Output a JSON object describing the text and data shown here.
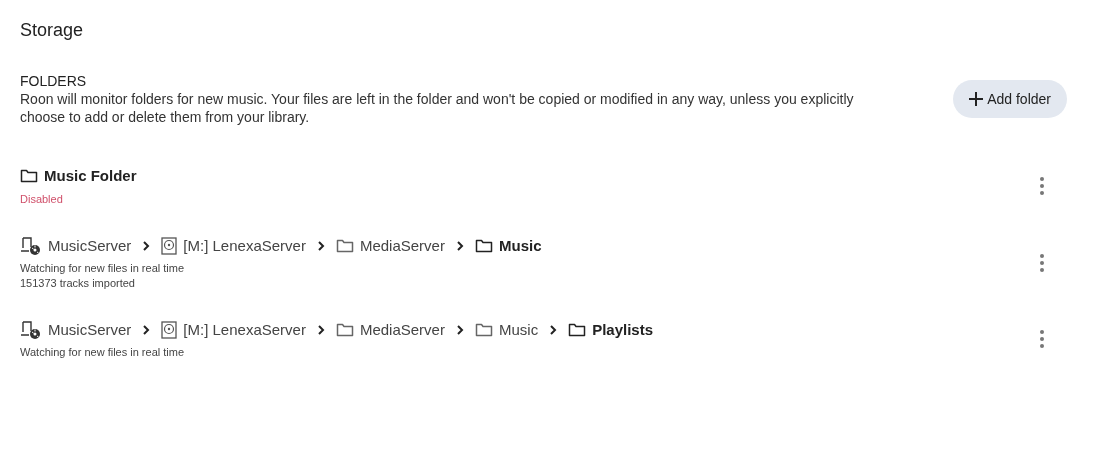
{
  "title": "Storage",
  "section": {
    "heading": "FOLDERS",
    "description": "Roon will monitor folders for new music. Your files are left in the folder and won't be copied or modified in any way, unless you explicitly choose to add or delete them from your library.",
    "button": "Add folder"
  },
  "folders": [
    {
      "path": [
        {
          "kind": "folder",
          "label": "Music Folder"
        }
      ],
      "notes": [
        {
          "kind": "error",
          "text": "Disabled"
        }
      ]
    },
    {
      "path": [
        {
          "kind": "computer",
          "label": "MusicServer"
        },
        {
          "kind": "drive",
          "label": "[M:] LenexaServer"
        },
        {
          "kind": "folder",
          "label": "MediaServer"
        },
        {
          "kind": "folder",
          "label": "Music"
        }
      ],
      "notes": [
        {
          "kind": "info",
          "text": "Watching for new files in real time"
        },
        {
          "kind": "info",
          "text": "151373 tracks imported"
        }
      ]
    },
    {
      "path": [
        {
          "kind": "computer",
          "label": "MusicServer"
        },
        {
          "kind": "drive",
          "label": "[M:] LenexaServer"
        },
        {
          "kind": "folder",
          "label": "MediaServer"
        },
        {
          "kind": "folder",
          "label": "Music"
        },
        {
          "kind": "folder",
          "label": "Playlists"
        }
      ],
      "notes": [
        {
          "kind": "info",
          "text": "Watching for new files in real time"
        }
      ]
    }
  ]
}
